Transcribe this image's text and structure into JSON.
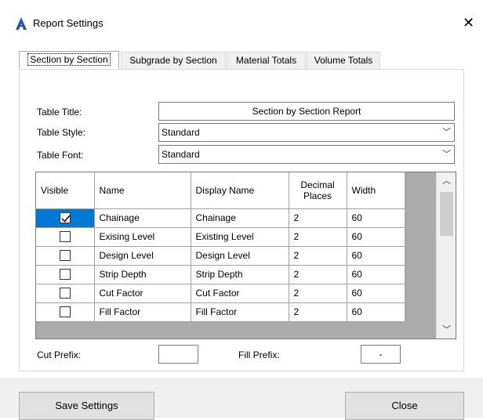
{
  "window": {
    "title": "Report Settings",
    "close_glyph": "✕",
    "app_icon": "civil-3d-a-icon"
  },
  "tabs": [
    {
      "label": "Section by Section",
      "active": true
    },
    {
      "label": "Subgrade by Section",
      "active": false
    },
    {
      "label": "Material Totals",
      "active": false
    },
    {
      "label": "Volume Totals",
      "active": false
    }
  ],
  "form": {
    "table_title_label": "Table Title:",
    "table_title_value": "Section by Section Report",
    "table_style_label": "Table Style:",
    "table_style_value": "Standard",
    "table_font_label": "Table Font:",
    "table_font_value": "Standard",
    "dropdown_glyph": "﹀"
  },
  "grid": {
    "headers": [
      "Visible",
      "Name",
      "Display Name",
      "Decimal Places",
      "Width"
    ],
    "header_decimal_line1": "Decimal",
    "header_decimal_line2": "Places",
    "rows": [
      {
        "visible": true,
        "name": "Chainage",
        "display": "Chainage",
        "decimals": "2",
        "width": "60"
      },
      {
        "visible": false,
        "name": "Exising Level",
        "display": "Existing Level",
        "decimals": "2",
        "width": "60"
      },
      {
        "visible": false,
        "name": "Design Level",
        "display": "Design Level",
        "decimals": "2",
        "width": "60"
      },
      {
        "visible": false,
        "name": "Strip Depth",
        "display": "Strip Depth",
        "decimals": "2",
        "width": "60"
      },
      {
        "visible": false,
        "name": "Cut Factor",
        "display": "Cut Factor",
        "decimals": "2",
        "width": "60"
      },
      {
        "visible": false,
        "name": "Fill Factor",
        "display": "Fill Factor",
        "decimals": "2",
        "width": "60"
      }
    ],
    "scroll_up_glyph": "︿",
    "scroll_down_glyph": "﹀",
    "selection_color": "#0078d7"
  },
  "prefix": {
    "cut_label": "Cut Prefix:",
    "cut_value": "",
    "fill_label": "Fill Prefix:",
    "fill_value": "-"
  },
  "buttons": {
    "save": "Save Settings",
    "close": "Close"
  }
}
